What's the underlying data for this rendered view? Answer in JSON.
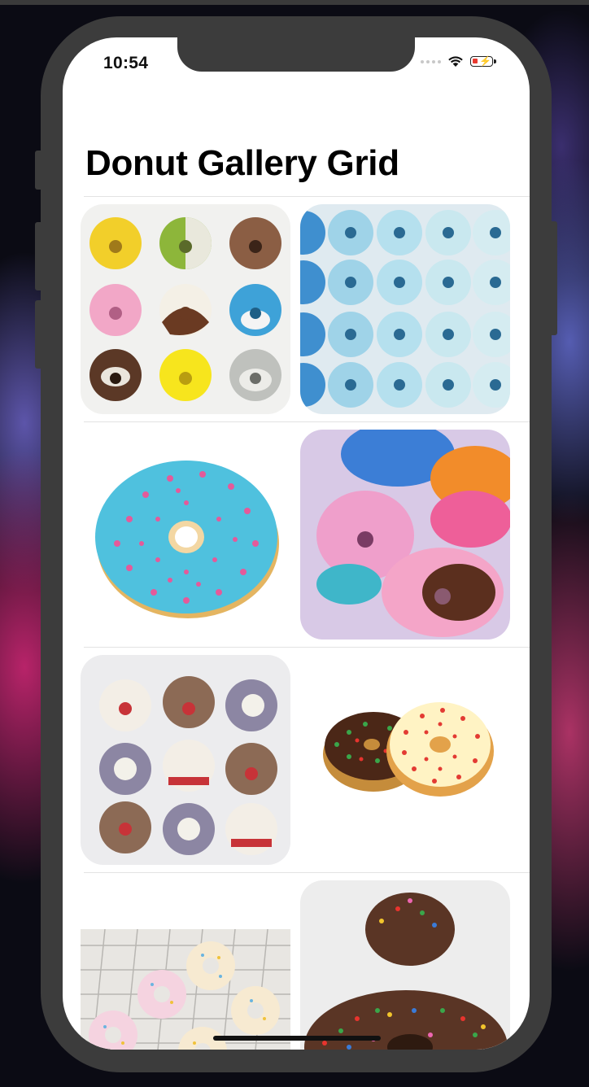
{
  "status_bar": {
    "time": "10:54",
    "icons": [
      "cellular-signal-icon",
      "wifi-icon",
      "battery-charging-icon"
    ]
  },
  "page": {
    "title": "Donut Gallery Grid"
  },
  "gallery": {
    "images": [
      "animal-face-donuts-image",
      "blue-sprinkle-donuts-image",
      "blue-glazed-donut-image",
      "squishy-donut-toys-image",
      "christmas-animal-donuts-image",
      "sprinkle-donut-pair-image",
      "pastel-donuts-on-rack-image",
      "rainbow-sprinkle-donut-image"
    ]
  },
  "colors": {
    "background": "#ffffff",
    "title": "#000000",
    "device_frame": "#3c3c3c",
    "separator": "#e3e3e3"
  }
}
